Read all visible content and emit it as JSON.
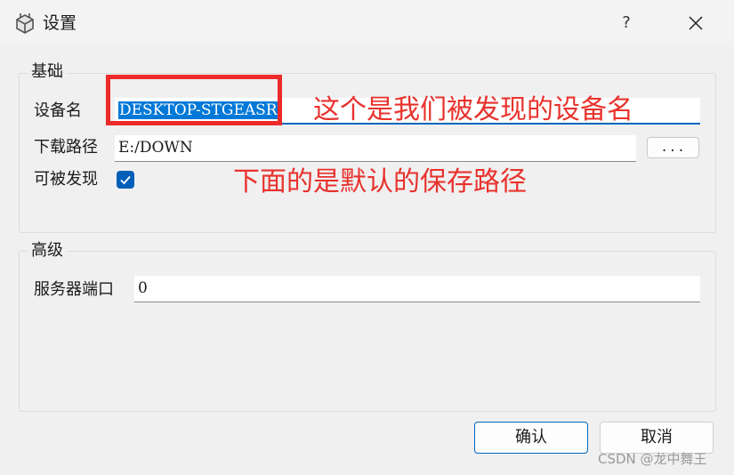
{
  "window": {
    "title": "设置",
    "help_label": "?"
  },
  "basic_group": {
    "title": "基础",
    "device_name_label": "设备名",
    "device_name_value": "DESKTOP-STGEASR",
    "download_path_label": "下载路径",
    "download_path_value": "E:/DOWN",
    "browse_label": "...",
    "discoverable_label": "可被发现",
    "discoverable_checked": true
  },
  "advanced_group": {
    "title": "高级",
    "server_port_label": "服务器端口",
    "server_port_value": "0"
  },
  "buttons": {
    "ok_label": "确认",
    "cancel_label": "取消"
  },
  "annotations": {
    "device_name_note": "这个是我们被发现的设备名",
    "download_path_note": "下面的是默认的保存路径",
    "color": "#e8322d"
  },
  "watermark": "CSDN @龙中舞王",
  "colors": {
    "accent": "#005fb8",
    "selection": "#0078d7",
    "highlight_box": "#ec2a2a"
  }
}
